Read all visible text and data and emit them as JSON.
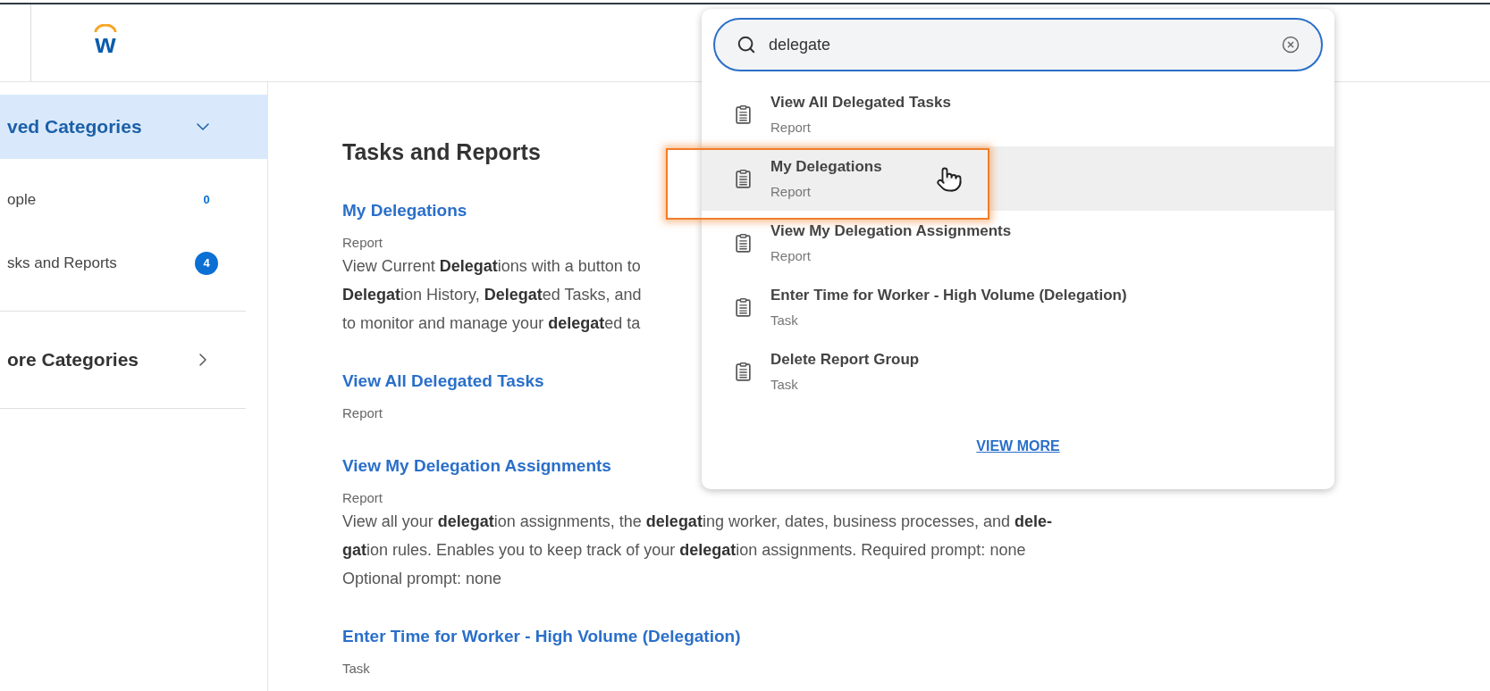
{
  "header": {
    "logo": {
      "text": "w"
    }
  },
  "sidebar": {
    "items": [
      {
        "kind": "section",
        "label": "ved Categories",
        "selected": true,
        "expanded": true
      },
      {
        "kind": "category",
        "label": "ople",
        "count": "0",
        "badge": false
      },
      {
        "kind": "category",
        "label": "sks and Reports",
        "count": "4",
        "badge": true
      },
      {
        "kind": "section",
        "label": "ore Categories",
        "selected": false,
        "expanded": false
      }
    ]
  },
  "main": {
    "heading": "Tasks and Reports",
    "results": [
      {
        "title": "My Delegations",
        "type": "Report",
        "description": [
          "View Current **Delegat**ions with a button to",
          "**Delegat**ion History, **Delegat**ed Tasks, and",
          "to monitor and manage your **delegat**ed ta"
        ]
      },
      {
        "title": "View All Delegated Tasks",
        "type": "Report"
      },
      {
        "title": "View My Delegation Assignments",
        "type": "Report",
        "description": [
          "View all your **delegat**ion assignments, the **delegat**ing worker, dates, business processes, and **dele-**",
          "**gat**ion rules. Enables you to keep track of your **delegat**ion assignments. Required prompt: none",
          "Optional prompt: none"
        ]
      },
      {
        "title": "Enter Time for Worker - High Volume (Delegation)",
        "type": "Task"
      }
    ]
  },
  "search": {
    "value": "delegate",
    "suggestions": [
      {
        "title": "View All Delegated Tasks",
        "type": "Report",
        "selected": false
      },
      {
        "title": "My Delegations",
        "type": "Report",
        "selected": true
      },
      {
        "title": "View My Delegation Assignments",
        "type": "Report",
        "selected": false
      },
      {
        "title": "Enter Time for Worker - High Volume (Delegation)",
        "type": "Task",
        "selected": false
      },
      {
        "title": "Delete Report Group",
        "type": "Task",
        "selected": false
      }
    ],
    "view_more": "VIEW MORE"
  }
}
